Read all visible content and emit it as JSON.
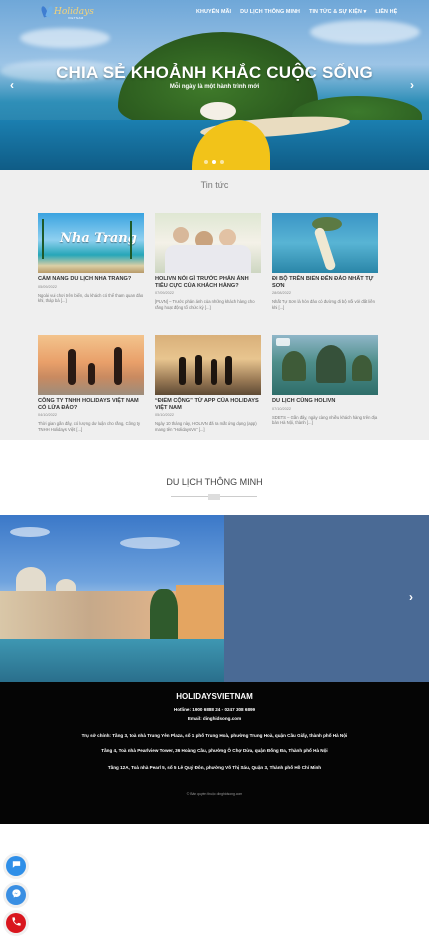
{
  "logo": {
    "brand": "Holidays",
    "sub": "VIETNAM"
  },
  "nav": {
    "items": [
      {
        "label": "KHUYẾN MÃI"
      },
      {
        "label": "DU LỊCH THÔNG MINH"
      },
      {
        "label": "TIN TỨC & SỰ KIỆN"
      },
      {
        "label": "LIÊN HỆ"
      }
    ],
    "dropdown_icon": "chevron-down-icon"
  },
  "hero": {
    "title": "CHIA SẺ KHOẢNH KHẮC CUỘC SỐNG",
    "subtitle": "Mỗi ngày là một hành trình mới",
    "prev_icon": "chevron-left-icon",
    "next_icon": "chevron-right-icon",
    "slide_count": 3,
    "active_slide": 2
  },
  "news": {
    "title": "Tin tức",
    "items": [
      {
        "title": "CẨM NANG DU LỊCH NHA TRANG?",
        "image_label": "Nha Trang",
        "date": "05/09/2022",
        "excerpt": "Ngoài vui chơi trên biển, du khách có thể tham quan đảo khỉ, tháp bà [...]"
      },
      {
        "title": "HOLIVN NÓI GÌ TRƯỚC PHẢN ÁNH TIÊU CỰC CỦA KHÁCH HÀNG?",
        "date": "07/09/2022",
        "excerpt": "[PLVN] – Trước phản ánh của những khách hàng cho rằng hoạt động tổ chức kỳ [...]"
      },
      {
        "title": "ĐI BỘ TRÊN BIỂN ĐẾN ĐẢO NHẤT TỰ SƠN",
        "date": "28/08/2022",
        "excerpt": "Nhất Tự Sơn là hòn đảo có đường đi bộ nối với đất liền khi [...]"
      },
      {
        "title": "CÔNG TY TNHH HOLIDAYS VIỆT NAM CÓ LỪA ĐẢO?",
        "date": "04/10/2022",
        "excerpt": "Thời gian gần đây, có lượng dư luận cho rằng, Công ty TNHH Holidays Việt [...]"
      },
      {
        "title": "“ĐIỂM CỘNG” TỪ APP CỦA HOLIDAYS VIỆT NAM",
        "date": "05/10/2022",
        "excerpt": "Ngày 10 tháng này, HOLIVN đã ra mắt ứng dụng (app) mang tên “HolidaysVn” [...]"
      },
      {
        "title": "DU LỊCH CÙNG HOLIVN",
        "date": "07/10/2022",
        "excerpt": "SDETS – Gần đây, ngày càng nhiều khách hàng trên địa bàn Hà Nội, thành [...]"
      }
    ]
  },
  "smart": {
    "title": "DU LỊCH THÔNG MINH",
    "next_icon": "chevron-right-icon"
  },
  "footer": {
    "brand": "HOLIDAYSVIETNAM",
    "hotline": "Hotline: 1900 6888 24 - 0247 308 6899",
    "email": "Email: dinghidsong.com",
    "address1": "Trụ sở chính: Tầng 3, toà nhà Trung Yên Plaza, số 1 phố Trung Hoà, phường Trung Hoà, quận Cầu Giấy, thành phố Hà Nội",
    "address2": "Tầng 4, Toà nhà Pearlview Tower, 36 Hoàng Cầu, phường Ô Chợ Dừa, quận Đống Đa, Thành phố Hà Nội",
    "address3": "Tầng 12A, Toà nhà Pearl 5, số 5 Lê Quý Đôn, phường Võ Thị Sáu, Quận 3, Thành phố Hồ Chí Minh",
    "copyright": "© Bản quyền thuộc dinghidsong.com"
  },
  "floating": {
    "chat_icon": "chat-bubble-icon",
    "messenger_icon": "messenger-icon",
    "phone_icon": "phone-icon",
    "colors": {
      "chat": "#2f8fe8",
      "messenger": "#3a8fe3",
      "phone": "#d9161e"
    }
  }
}
